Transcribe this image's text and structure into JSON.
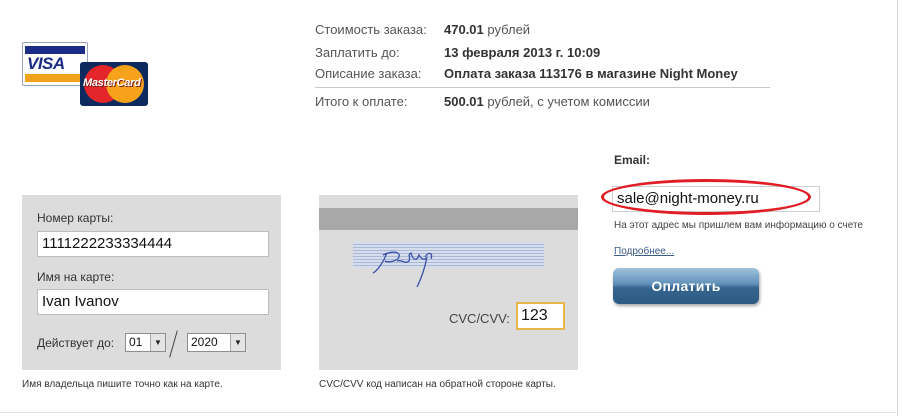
{
  "logos": {
    "visa": {
      "text": "VISA",
      "icon": "visa-logo",
      "colors": {
        "blue": "#1a2c86",
        "gold": "#f0a21a"
      }
    },
    "mastercard": {
      "text": "MasterCard",
      "icon": "mastercard-logo",
      "colors": {
        "red": "#e4262a",
        "yellow": "#f7a21b"
      }
    }
  },
  "order": {
    "cost_label": "Стоимость заказа:",
    "cost_value": "470.01",
    "cost_unit": "рублей",
    "pay_until_label": "Заплатить до:",
    "pay_until_value": "13 февраля 2013 г. 10:09",
    "description_label": "Описание заказа:",
    "description_value": "Оплата заказа 113176 в магазине Night Money",
    "total_label": "Итого к оплате:",
    "total_value": "500.01",
    "total_suffix": "рублей, с учетом комиссии"
  },
  "card_front": {
    "number_label": "Номер карты:",
    "number_value": "1111222233334444",
    "name_label": "Имя на карте:",
    "name_value": "Ivan Ivanov",
    "expiry_label": "Действует до:",
    "expiry_month": "01",
    "expiry_year": "2020",
    "note": "Имя владельца пишите точно как на карте."
  },
  "card_back": {
    "cvc_label": "CVC/CVV:",
    "cvc_value": "123",
    "note": "CVC/CVV код написан на обратной стороне карты."
  },
  "email": {
    "label": "Email:",
    "value": "sale@night-money.ru",
    "note": "На этот адрес мы пришлем вам информацию о счете",
    "more_link": "Подробнее...",
    "highlight_color": "#e01d24"
  },
  "pay_button": {
    "label": "Оплатить"
  }
}
